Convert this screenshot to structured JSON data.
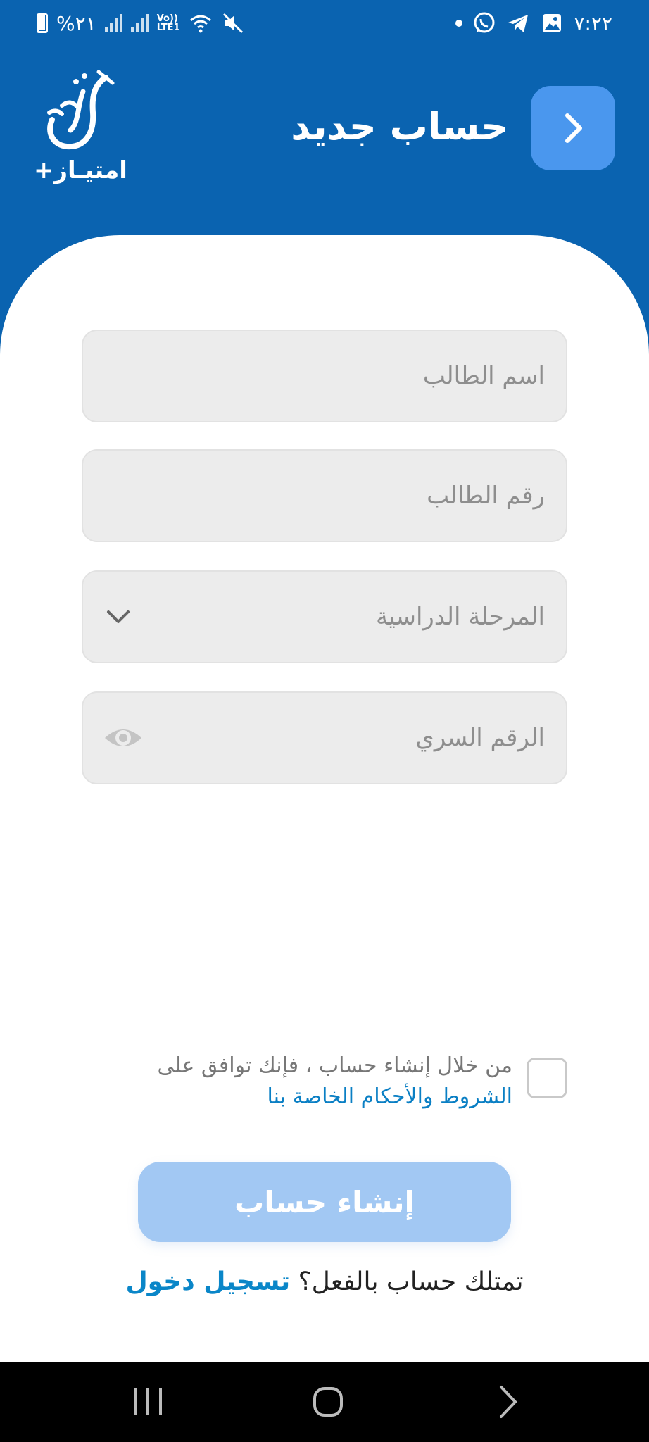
{
  "status_bar": {
    "battery": "%٢١",
    "network": "LTE1",
    "volte": "Vo))",
    "time": "٧:٢٢",
    "icons": [
      "battery-icon",
      "signal-icon",
      "signal-icon",
      "wifi-icon",
      "mute-icon",
      "dot-icon",
      "whatsapp-icon",
      "telegram-icon",
      "gallery-icon"
    ]
  },
  "header": {
    "title": "حساب جديد",
    "logo_text": "امتيـاز+",
    "back_icon": "chevron-right-icon"
  },
  "form": {
    "student_name_placeholder": "اسم الطالب",
    "student_number_placeholder": "رقم الطالب",
    "stage_placeholder": "المرحلة الدراسية",
    "password_placeholder": "الرقم السري",
    "terms_text": "من خلال إنشاء حساب ، فإنك توافق على",
    "terms_link": "الشروط والأحكام الخاصة بنا",
    "create_button": "إنشاء حساب",
    "have_account": "تمتلك حساب بالفعل؟",
    "login_link": "تسجيل دخول"
  },
  "colors": {
    "brand_blue": "#0a63b0",
    "back_button": "#4a97ee",
    "button_disabled": "#a2c8f3",
    "link": "#0a86c8",
    "field_bg": "#ececec"
  }
}
